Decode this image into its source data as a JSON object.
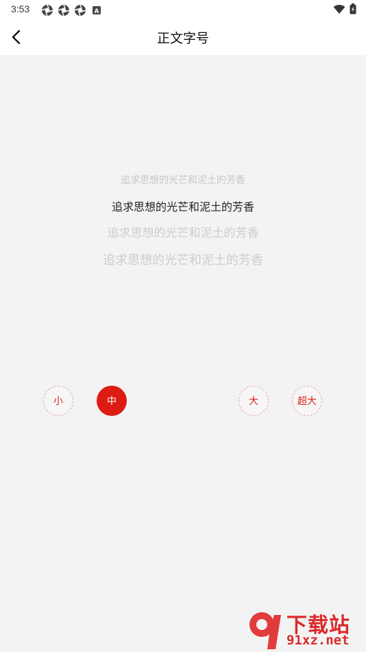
{
  "status_bar": {
    "time": "3:53",
    "left_icons": [
      "camera-shutter-icon",
      "camera-shutter-icon",
      "camera-shutter-icon",
      "keyboard-a-icon"
    ],
    "right_icons": [
      "wifi-icon",
      "battery-icon"
    ]
  },
  "header": {
    "title": "正文字号",
    "back_icon": "chevron-left-icon"
  },
  "preview": {
    "small": "追求思想的光芒和泥土的芳香",
    "medium": "追求思想的光芒和泥土的芳香",
    "large": "追求思想的光芒和泥土的芳香",
    "xlarge": "追求思想的光芒和泥土的芳香"
  },
  "size_options": {
    "small": "小",
    "medium": "中",
    "large": "大",
    "xlarge": "超大",
    "selected": "medium"
  },
  "colors": {
    "accent": "#dc1c12",
    "background": "#f3f3f3"
  },
  "watermark": {
    "title": "下载站",
    "url": "91xz.net"
  }
}
